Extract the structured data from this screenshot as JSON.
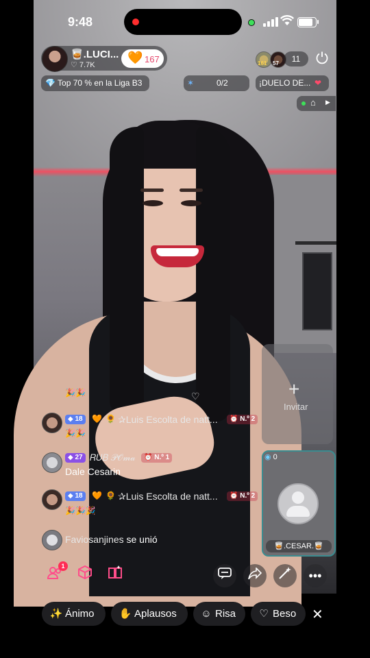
{
  "status_bar": {
    "time": "9:48"
  },
  "host": {
    "name": "🥃.LUCI...",
    "likes": "♡ 7.7K",
    "follow_heart": "🧡",
    "follow_count": "167"
  },
  "viewers": {
    "top1_num": "161",
    "top2_num": "57",
    "count": "11"
  },
  "badges": {
    "league": "💎 Top 70 % en la Liga B3",
    "goal": "0/2",
    "duel": "¡DUELO DE..."
  },
  "invite": {
    "label": "Invitar"
  },
  "guest": {
    "count": "0",
    "name": "🥃.CESAR.🥃"
  },
  "chat": [
    {
      "emojis": "🎉🎉"
    },
    {
      "level": "18",
      "heart": "🧡",
      "sun": "🌻",
      "name": "✰Luis Escolta de natt...",
      "rank": "⏰ N.º 2",
      "emojis": "🎉🎉"
    },
    {
      "level": "27",
      "name": "𝑅𝑈𝐵 𝒫𝒪𝓂𝒶",
      "rank": "⏰ N.º 1",
      "text": "Dale Cesarin"
    },
    {
      "level": "18",
      "heart": "🧡",
      "sun": "🌻",
      "name": "✰Luis Escolta de natt...",
      "rank": "⏰ N.º 2",
      "emojis": "🎉🎉🎉"
    },
    {
      "name": "Faviosanjines",
      "text": "se unió"
    }
  ],
  "bottom_bar": {
    "notif_count": "1"
  },
  "reactions": [
    {
      "icon": "👏",
      "label": "Ánimo"
    },
    {
      "icon": "👏",
      "label": "Aplausos"
    },
    {
      "icon": "😀",
      "label": "Risa"
    },
    {
      "icon": "♡",
      "label": "Beso"
    }
  ],
  "colors": {
    "follow_count": "#e4466b",
    "level_blue": "#5b7ff0",
    "level_purple": "#8b50e6",
    "guest_border": "#3b8c90",
    "notif": "#ff2d55"
  }
}
